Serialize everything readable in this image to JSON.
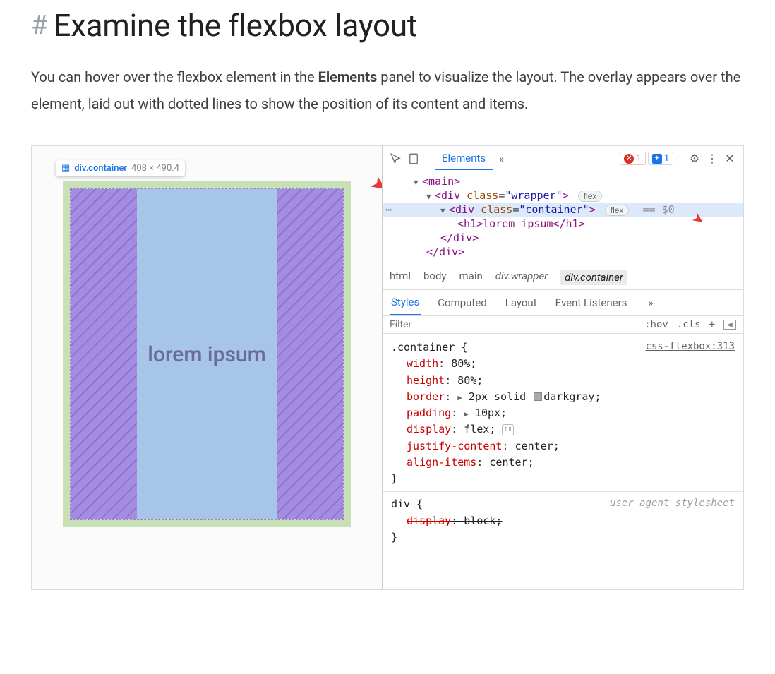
{
  "heading": {
    "hash": "#",
    "title": "Examine the flexbox layout"
  },
  "intro": {
    "part1": "You can hover over the flexbox element in the ",
    "bold": "Elements",
    "part2": " panel to visualize the layout. The overlay appears over the element, laid out with dotted lines to show the position of its content and items."
  },
  "tooltip": {
    "selector": "div.container",
    "dims": "408 × 490.4"
  },
  "preview": {
    "center_text": "lorem ipsum"
  },
  "toolbar": {
    "tab_elements": "Elements",
    "errors": "1",
    "messages": "1"
  },
  "dom": {
    "main_open": "<main>",
    "wrapper": {
      "open": "<div ",
      "class_label": "class",
      "eq": "=",
      "class_val": "\"wrapper\"",
      "close": ">",
      "pill": "flex"
    },
    "container": {
      "open": "<div ",
      "class_label": "class",
      "eq": "=",
      "class_val": "\"container\"",
      "close": ">",
      "pill": "flex",
      "eq0": "== $0"
    },
    "h1": "<h1>lorem ipsum</h1>",
    "div_close1": "</div>",
    "div_close2": "</div>",
    "ellipsis": "⋯"
  },
  "breadcrumb": [
    "html",
    "body",
    "main",
    "div.wrapper",
    "div.container"
  ],
  "style_tabs": [
    "Styles",
    "Computed",
    "Layout",
    "Event Listeners"
  ],
  "filter": {
    "placeholder": "Filter",
    "hov": ":hov",
    "cls": ".cls",
    "plus": "+"
  },
  "css": {
    "rule1": {
      "selector": ".container {",
      "source": "css-flexbox:313",
      "props": [
        {
          "name": "width",
          "value": "80%;"
        },
        {
          "name": "height",
          "value": "80%;"
        },
        {
          "name": "border",
          "tri": true,
          "swatch": true,
          "value_pre": "2px solid ",
          "value_post": "darkgray;"
        },
        {
          "name": "padding",
          "tri": true,
          "value": "10px;"
        },
        {
          "name": "display",
          "value": "flex;",
          "flex_icon": true
        },
        {
          "name": "justify-content",
          "value": "center;"
        },
        {
          "name": "align-items",
          "value": "center;"
        }
      ],
      "close": "}"
    },
    "rule2": {
      "selector": "div {",
      "ua": "user agent stylesheet",
      "strike_prop": "display",
      "strike_val": "block;",
      "close": "}"
    }
  }
}
